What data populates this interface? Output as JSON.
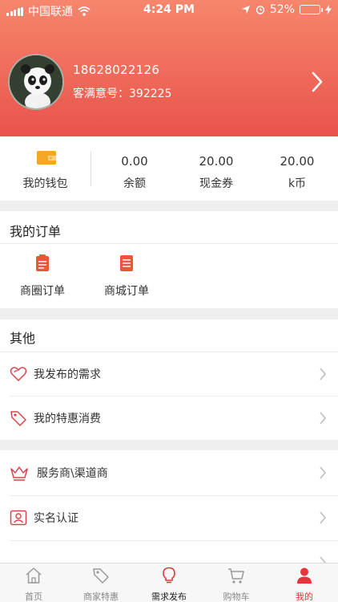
{
  "status_bar": {
    "carrier": "中国联通",
    "time": "4:24 PM",
    "battery": "52%",
    "battery_level": 0.52
  },
  "profile": {
    "phone": "18628022126",
    "customer_id": "客满意号：392225"
  },
  "wallet": {
    "label": "我的钱包",
    "items": [
      {
        "value": "0.00",
        "label": "余额"
      },
      {
        "value": "20.00",
        "label": "现金券"
      },
      {
        "value": "20.00",
        "label": "k币"
      }
    ]
  },
  "orders": {
    "title": "我的订单",
    "items": [
      {
        "label": "商圈订单"
      },
      {
        "label": "商城订单"
      }
    ]
  },
  "other": {
    "title": "其他",
    "rows": [
      {
        "label": "我发布的需求",
        "icon": "heart-outline-icon"
      },
      {
        "label": "我的特惠消费",
        "icon": "tag-icon"
      }
    ]
  },
  "services": {
    "rows": [
      {
        "label": "服务商\\渠道商",
        "icon": "crown-icon"
      },
      {
        "label": "实名认证",
        "icon": "id-card-icon"
      }
    ]
  },
  "tabbar": {
    "tabs": [
      {
        "label": "首页",
        "icon": "home-icon"
      },
      {
        "label": "商家特惠",
        "icon": "tag-icon"
      },
      {
        "label": "需求发布",
        "icon": "lightbulb-icon"
      },
      {
        "label": "购物车",
        "icon": "cart-icon"
      },
      {
        "label": "我的",
        "icon": "user-icon"
      }
    ],
    "active_index": 4
  },
  "colors": {
    "accent": "#e8333a",
    "header_top": "#f6866d",
    "header_bottom": "#e9534d",
    "wallet_icon": "#f5a623",
    "order_icon": "#f0553a"
  }
}
